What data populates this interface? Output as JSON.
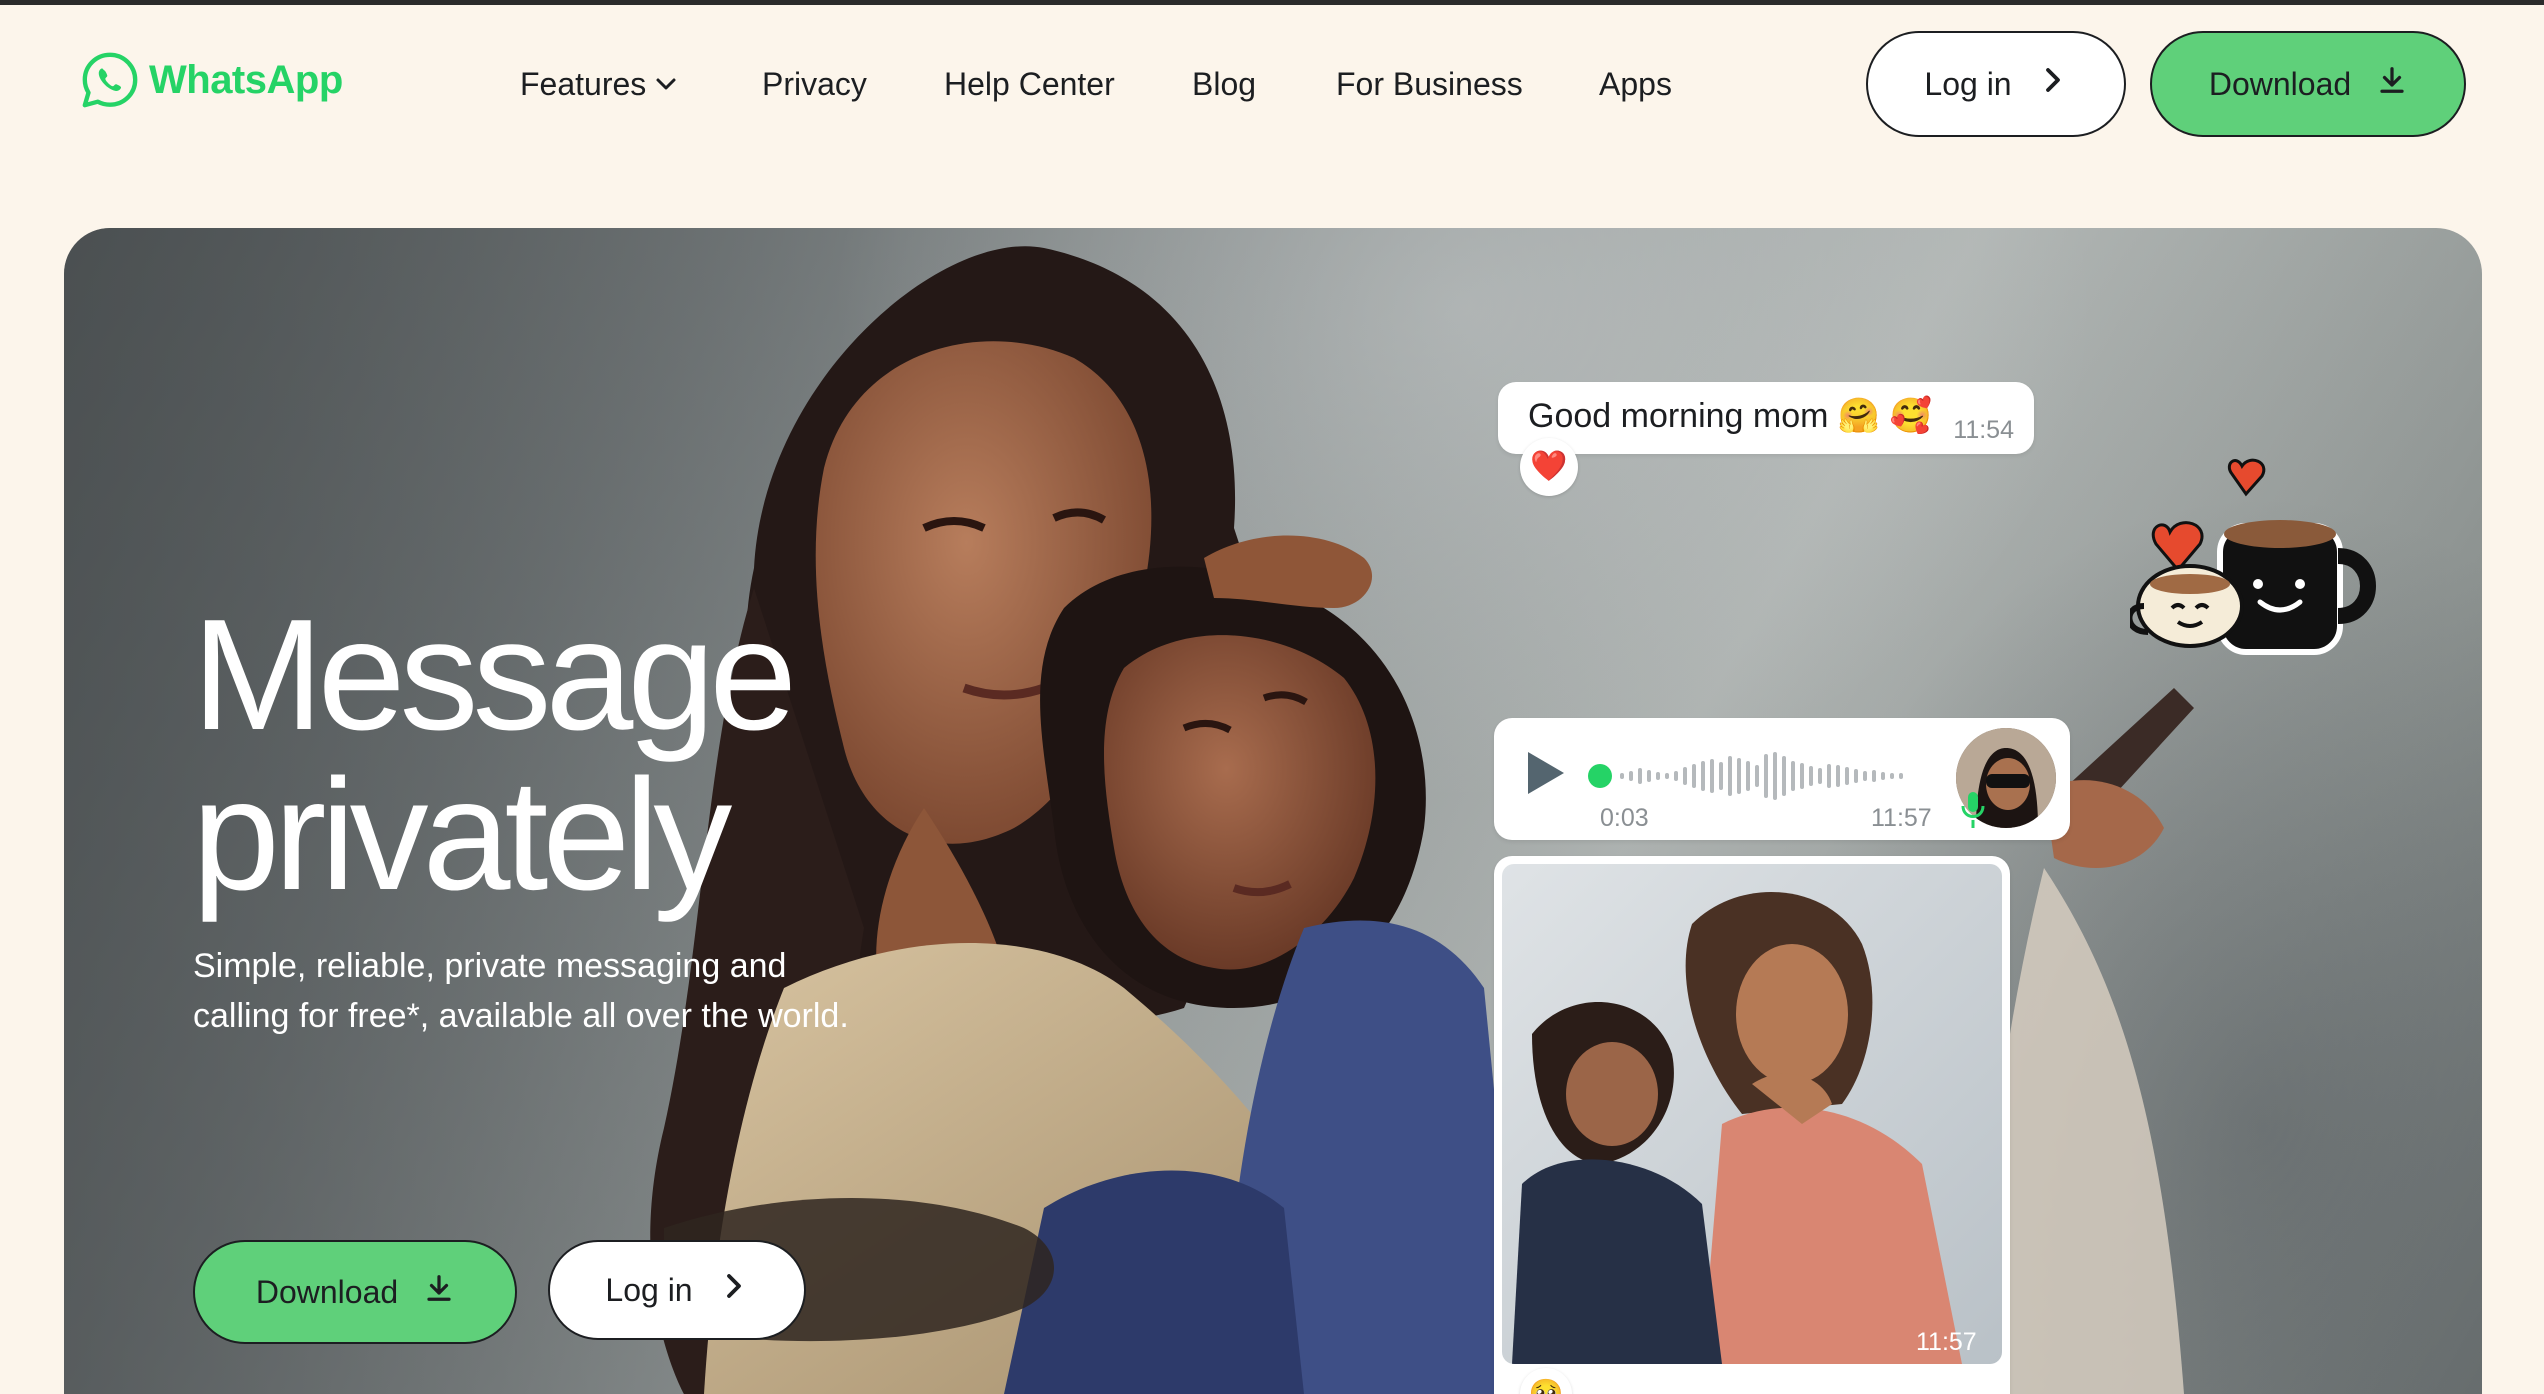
{
  "header": {
    "logo_text": "WhatsApp",
    "nav": [
      {
        "label": "Features",
        "has_dropdown": true
      },
      {
        "label": "Privacy"
      },
      {
        "label": "Help Center"
      },
      {
        "label": "Blog"
      },
      {
        "label": "For Business"
      },
      {
        "label": "Apps"
      }
    ],
    "login_label": "Log in",
    "download_label": "Download"
  },
  "hero": {
    "title_line1": "Message",
    "title_line2": "privately",
    "subtitle": "Simple, reliable, private messaging and calling for free*, available all over the world.",
    "download_label": "Download",
    "login_label": "Log in"
  },
  "chat": {
    "text_message": {
      "text": "Good morning mom 🤗 🥰",
      "time": "11:54",
      "reaction": "❤️"
    },
    "voice_message": {
      "elapsed": "0:03",
      "time": "11:57"
    },
    "photo_message": {
      "time": "11:57",
      "reaction": "🥹"
    }
  },
  "colors": {
    "brand_green": "#25d366",
    "button_green": "#5fd07a",
    "background": "#fcf5eb"
  },
  "icons": [
    "whatsapp-logo-icon",
    "chevron-down-icon",
    "chevron-right-icon",
    "download-icon",
    "play-icon",
    "microphone-icon",
    "heart-sticker-icon",
    "coffee-mug-sticker-icon"
  ]
}
